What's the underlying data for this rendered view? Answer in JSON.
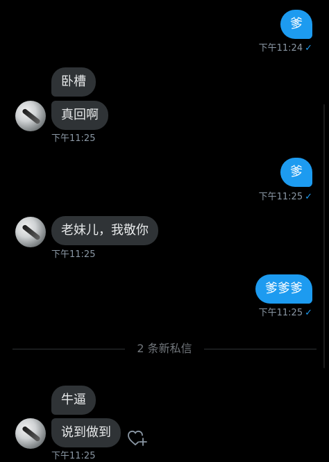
{
  "messages": {
    "out1": {
      "text": "爹",
      "time": "下午11:24",
      "check": "✓"
    },
    "in1": {
      "lines": [
        "卧槽",
        "真回啊"
      ],
      "time": "下午11:25"
    },
    "out2": {
      "text": "爹",
      "time": "下午11:25",
      "check": "✓"
    },
    "in2": {
      "text": "老妹儿，我敬你",
      "time": "下午11:25"
    },
    "out3": {
      "text": "爹爹爹",
      "time": "下午11:25",
      "check": "✓"
    },
    "divider": {
      "text": "2 条新私信"
    },
    "in3": {
      "lines": [
        "牛逼",
        "说到做到"
      ],
      "time": "下午11:25"
    }
  },
  "icons": {
    "read_receipt": "check-icon",
    "like_reaction": "heart-plus-icon",
    "avatar": "user-avatar"
  },
  "colors": {
    "background": "#000000",
    "outgoing_bubble": "#1d9bf0",
    "incoming_bubble": "#2f3336",
    "meta_text": "#8b98a5"
  }
}
